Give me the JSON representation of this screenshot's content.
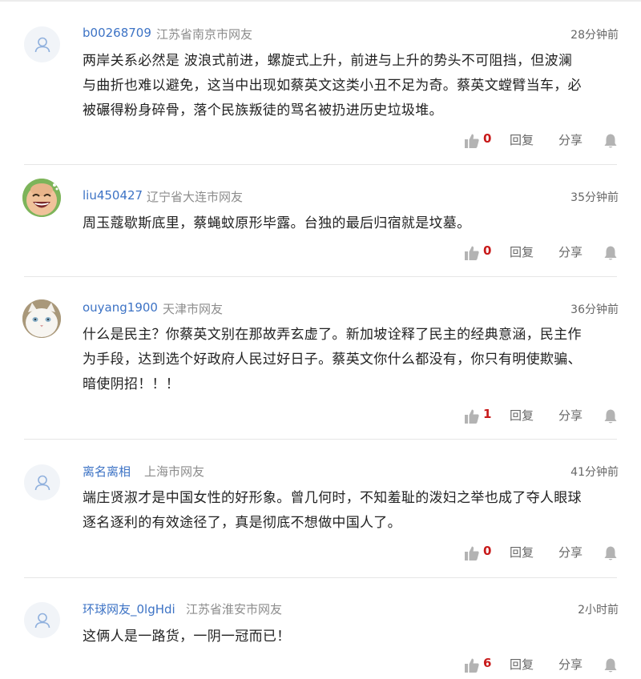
{
  "comments": [
    {
      "username": "b00268709",
      "location": "江苏省南京市网友",
      "time": "28分钟前",
      "avatar": "default-user-icon",
      "lines": [
        "两岸关系必然是 波浪式前进，螺旋式上升，前进与上升的势头不可阻挡，但波澜",
        "与曲折也难以避免，这当中出现如蔡英文这类小丑不足为奇。蔡英文螳臂当车，必",
        "被碾得粉身碎骨，落个民族叛徒的骂名被扔进历史垃圾堆。"
      ],
      "likes": "0",
      "reply_label": "回复",
      "share_label": "分享"
    },
    {
      "username": "liu450427",
      "location": "辽宁省大连市网友",
      "time": "35分钟前",
      "avatar": "laughing-face-avatar",
      "lines": [
        "周玉蔻歇斯底里，蔡蝇蚊原形毕露。台独的最后归宿就是坟墓。"
      ],
      "likes": "0",
      "reply_label": "回复",
      "share_label": "分享"
    },
    {
      "username": "ouyang1900",
      "location": "天津市网友",
      "time": "36分钟前",
      "avatar": "white-cat-avatar",
      "lines": [
        "什么是民主？你蔡英文别在那故弄玄虚了。新加坡诠释了民主的经典意涵，民主作",
        "为手段，达到选个好政府人民过好日子。蔡英文你什么都没有，你只有明使欺骗、",
        "暗使阴招！！！"
      ],
      "likes": "1",
      "reply_label": "回复",
      "share_label": "分享"
    },
    {
      "username": "离名离相",
      "location": "上海市网友",
      "time": "41分钟前",
      "avatar": "default-user-icon",
      "lines": [
        "端庄贤淑才是中国女性的好形象。曾几何时，不知羞耻的泼妇之举也成了夺人眼球",
        "逐名逐利的有效途径了，真是彻底不想做中国人了。"
      ],
      "likes": "0",
      "reply_label": "回复",
      "share_label": "分享"
    },
    {
      "username": "环球网友_0lgHdi",
      "location": "江苏省淮安市网友",
      "time": "2小时前",
      "avatar": "default-user-icon",
      "lines": [
        "这俩人是一路货，一阴一冠而已！"
      ],
      "likes": "6",
      "reply_label": "回复",
      "share_label": "分享"
    }
  ],
  "colors": {
    "username": "#3d73c5",
    "location": "#8d8d8d",
    "like_count": "#c81a1a",
    "icon_gray": "#b3b3b3"
  }
}
